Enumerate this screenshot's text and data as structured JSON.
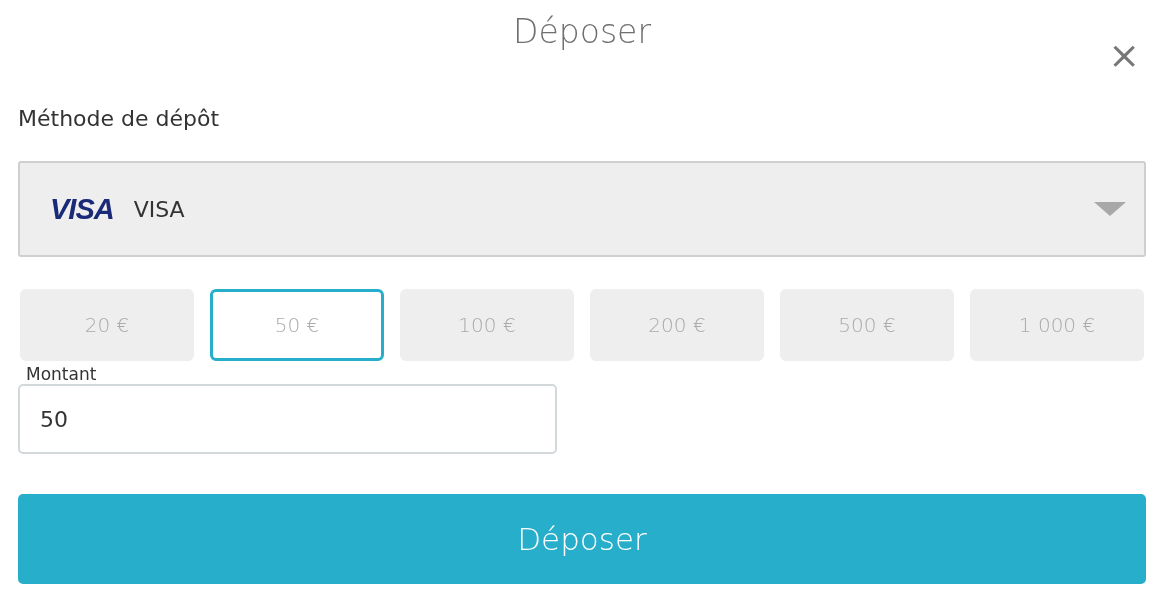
{
  "dialog": {
    "title": "Déposer",
    "close": "×"
  },
  "method": {
    "label": "Méthode de dépôt",
    "logo_text": "VISA",
    "value": "VISA"
  },
  "amounts": [
    {
      "label": "20 €",
      "selected": false
    },
    {
      "label": "50 €",
      "selected": true
    },
    {
      "label": "100 €",
      "selected": false
    },
    {
      "label": "200 €",
      "selected": false
    },
    {
      "label": "500 €",
      "selected": false
    },
    {
      "label": "1 000 €",
      "selected": false
    }
  ],
  "amount_field": {
    "label": "Montant",
    "value": "50"
  },
  "submit": "Déposer"
}
